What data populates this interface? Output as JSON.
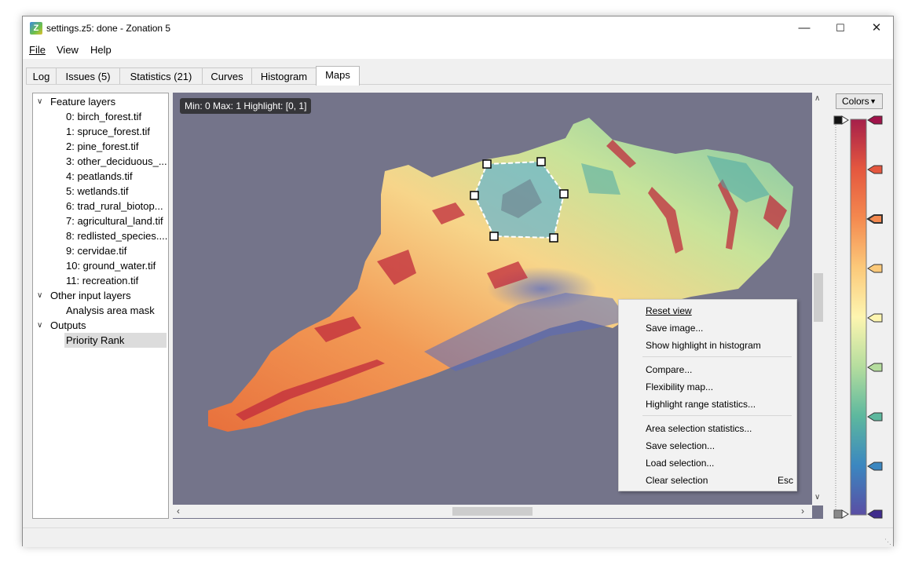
{
  "window": {
    "title": "settings.z5: done - Zonation 5",
    "minimize": "—",
    "maximize": "☐",
    "close": "✕"
  },
  "menu": {
    "file": "File",
    "view": "View",
    "help": "Help"
  },
  "tabs": [
    "Log",
    "Issues (5)",
    "Statistics (21)",
    "Curves",
    "Histogram",
    "Maps"
  ],
  "active_tab": "Maps",
  "tree": {
    "feature_group": "Feature layers",
    "features": [
      "0: birch_forest.tif",
      "1: spruce_forest.tif",
      "2: pine_forest.tif",
      "3: other_deciduous_...",
      "4: peatlands.tif",
      "5: wetlands.tif",
      "6: trad_rural_biotop...",
      "7: agricultural_land.tif",
      "8: redlisted_species....",
      "9: cervidae.tif",
      "10: ground_water.tif",
      "11: recreation.tif"
    ],
    "other_group": "Other input layers",
    "other_items": [
      "Analysis area mask"
    ],
    "outputs_group": "Outputs",
    "outputs_items": [
      "Priority Rank"
    ],
    "selected": "Priority Rank"
  },
  "map": {
    "info": "Min: 0 Max: 1 Highlight: [0, 1]",
    "background_color": "#74748a"
  },
  "context_menu": {
    "reset_view": "Reset view",
    "save_image": "Save image...",
    "show_highlight": "Show highlight in histogram",
    "compare": "Compare...",
    "flexibility_map": "Flexibility map...",
    "highlight_range_stats": "Highlight range statistics...",
    "area_selection_stats": "Area selection statistics...",
    "save_selection": "Save selection...",
    "load_selection": "Load selection...",
    "clear_selection": "Clear selection",
    "clear_selection_shortcut": "Esc"
  },
  "colors": {
    "button_label": "Colors",
    "stops": [
      "#a51f4a",
      "#e4573f",
      "#f4894f",
      "#fbc97a",
      "#fdf5b0",
      "#b5dd9e",
      "#5db89e",
      "#3b87c0",
      "#5a4ea4"
    ],
    "top_swatch": "#a0134a",
    "bottom_swatch": "#3f2c8c"
  }
}
